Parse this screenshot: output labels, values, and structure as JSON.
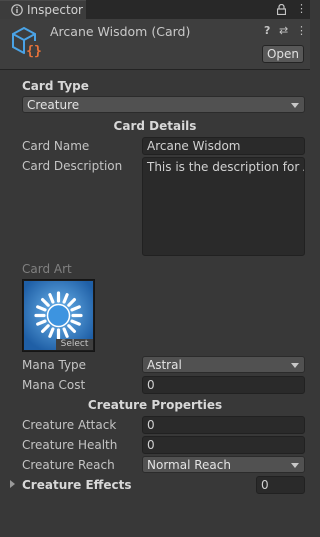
{
  "tab": {
    "label": "Inspector",
    "lock_icon": "lock-icon",
    "menu_icon": "kebab-menu-icon"
  },
  "header": {
    "title": "Arcane Wisdom (Card)",
    "open_label": "Open",
    "help_icon": "help-icon",
    "presets_icon": "presets-icon",
    "menu_icon": "kebab-menu-icon"
  },
  "card_type": {
    "label": "Card Type",
    "value": "Creature"
  },
  "card_details": {
    "title": "Card Details",
    "name_label": "Card Name",
    "name_value": "Arcane Wisdom",
    "description_label": "Card Description",
    "description_value": "This is the description for Arcane Wisdom",
    "art_label": "Card Art",
    "art_select": "Select",
    "mana_type_label": "Mana Type",
    "mana_type_value": "Astral",
    "mana_cost_label": "Mana Cost",
    "mana_cost_value": "0"
  },
  "creature_properties": {
    "title": "Creature Properties",
    "attack_label": "Creature Attack",
    "attack_value": "0",
    "health_label": "Creature Health",
    "health_value": "0",
    "reach_label": "Creature Reach",
    "reach_value": "Normal Reach",
    "effects_label": "Creature Effects",
    "effects_count": "0"
  },
  "colors": {
    "background": "#383838",
    "field": "#2a2a2a",
    "icon_blue": "#4aa3e6",
    "icon_orange": "#e8733a"
  }
}
